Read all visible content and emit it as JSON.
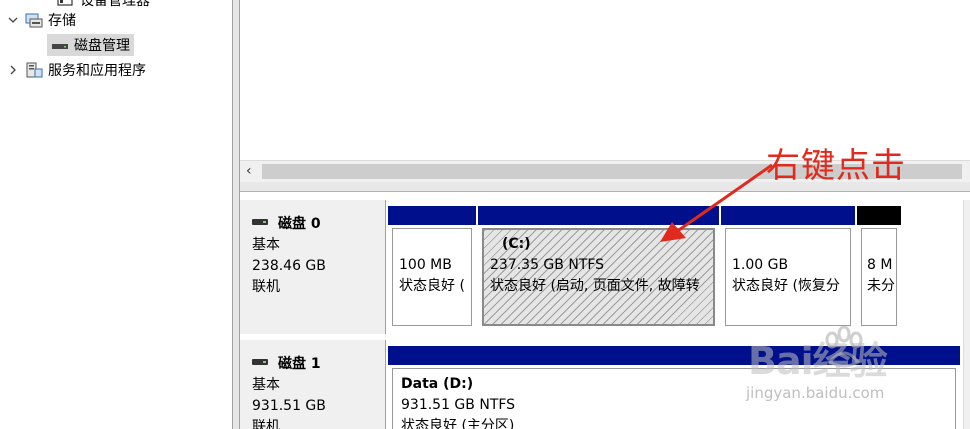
{
  "tree": {
    "cut_label": "设备管理器",
    "storage_label": "存储",
    "disk_management_label": "磁盘管理",
    "services_label": "服务和应用程序"
  },
  "disks": [
    {
      "title": "磁盘 0",
      "type": "基本",
      "size": "238.46 GB",
      "status": "联机"
    },
    {
      "title": "磁盘 1",
      "type": "基本",
      "size": "931.51 GB",
      "status": "联机"
    }
  ],
  "partitions0": [
    {
      "name": "",
      "size": "100 MB",
      "status": "状态良好 ("
    },
    {
      "name": "(C:)",
      "size": "237.35 GB NTFS",
      "status": "状态良好 (启动, 页面文件, 故障转"
    },
    {
      "name": "",
      "size": "1.00 GB",
      "status": "状态良好 (恢复分"
    },
    {
      "name": "",
      "size": "8 M",
      "status": "未分"
    }
  ],
  "partitions1": [
    {
      "name": "Data  (D:)",
      "size": "931.51 GB NTFS",
      "status": "状态良好 (主分区)"
    }
  ],
  "annotation": {
    "text": "右键点击",
    "color": "#e02a1e"
  },
  "watermark": {
    "brand": "Bai经验",
    "url": "jingyan.baidu.com"
  },
  "colors": {
    "primary_partition_bar": "#00108c",
    "unallocated_bar": "#000000"
  }
}
